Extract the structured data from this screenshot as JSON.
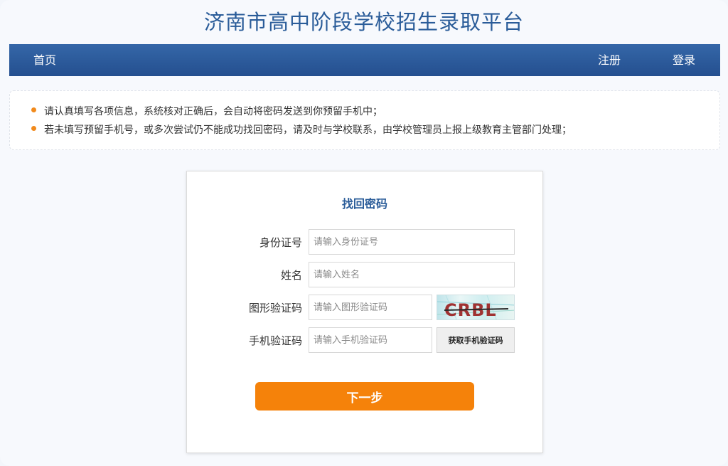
{
  "site": {
    "title": "济南市高中阶段学校招生录取平台"
  },
  "nav": {
    "home": "首页",
    "register": "注册",
    "login": "登录"
  },
  "notice": {
    "lines": [
      "请认真填写各项信息，系统核对正确后，会自动将密码发送到你预留手机中；",
      "若未填写预留手机号，或多次尝试仍不能成功找回密码，请及时与学校联系，由学校管理员上报上级教育主管部门处理；"
    ]
  },
  "form": {
    "title": "找回密码",
    "id_number": {
      "label": "身份证号",
      "placeholder": "请输入身份证号",
      "value": ""
    },
    "name": {
      "label": "姓名",
      "placeholder": "请输入姓名",
      "value": ""
    },
    "image_code": {
      "label": "图形验证码",
      "placeholder": "请输入图形验证码",
      "value": "",
      "captcha_text": "CRBL"
    },
    "sms_code": {
      "label": "手机验证码",
      "placeholder": "请输入手机验证码",
      "value": "",
      "button": "获取手机验证码"
    },
    "next_button": "下一步"
  },
  "colors": {
    "brand_blue": "#2a5c99",
    "nav_blue": "#2d5d9f",
    "accent_orange": "#f5820a",
    "bullet_orange": "#f18a1c"
  }
}
